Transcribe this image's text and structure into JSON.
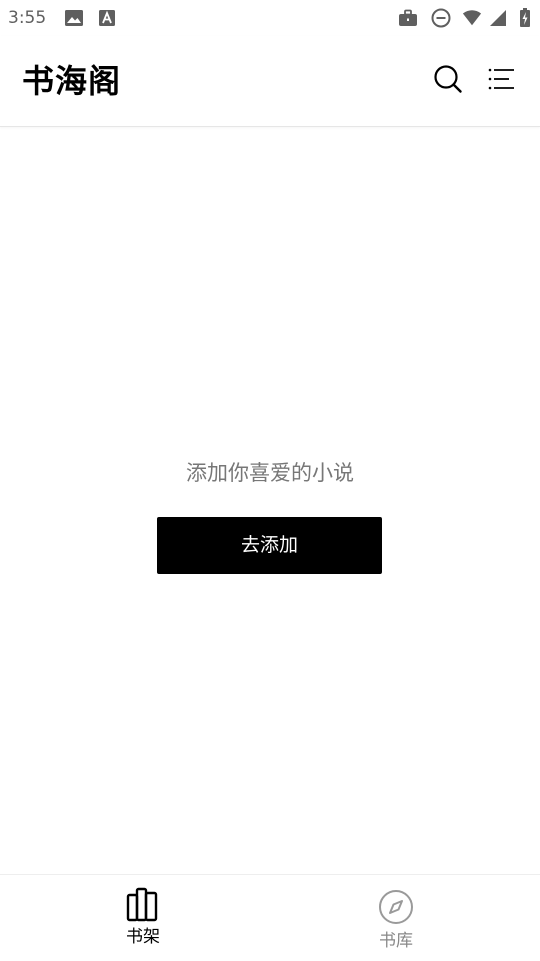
{
  "status_bar": {
    "time": "3:55",
    "icons": [
      "image-icon",
      "font-download-icon",
      "briefcase-icon",
      "do-not-disturb-icon",
      "wifi-icon",
      "signal-icon",
      "battery-charging-icon"
    ]
  },
  "header": {
    "app_title": "书海阁",
    "icons": [
      "search-icon",
      "menu-icon"
    ]
  },
  "empty_state": {
    "message": "添加你喜爱的小说",
    "button_label": "去添加"
  },
  "bottom_nav": {
    "items": [
      {
        "label": "书架",
        "icon": "bookshelf-icon",
        "active": true
      },
      {
        "label": "书库",
        "icon": "compass-icon",
        "active": false
      }
    ]
  },
  "colors": {
    "accent": "#000000",
    "background": "#ffffff",
    "muted_text": "#777777",
    "inactive_nav": "#888888"
  }
}
